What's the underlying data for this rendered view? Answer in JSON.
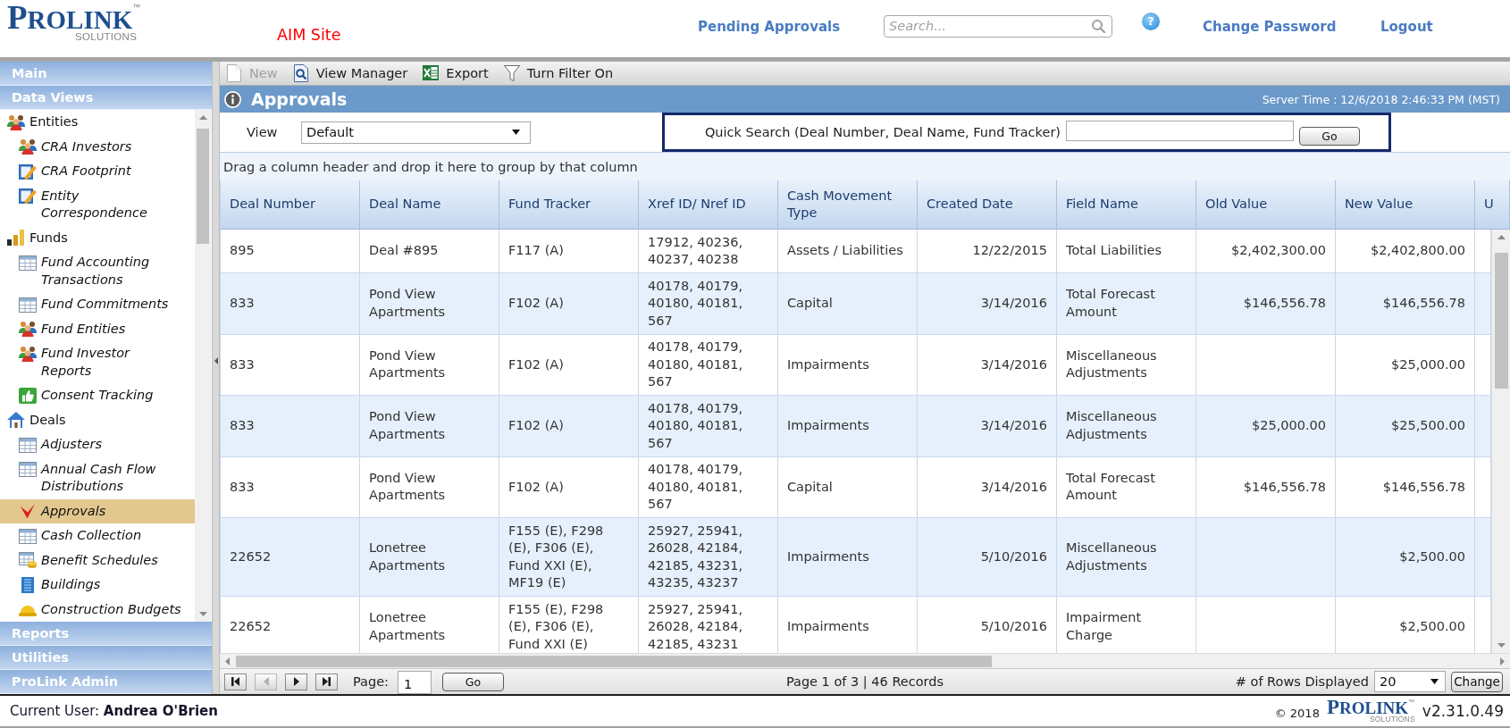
{
  "header": {
    "logo": {
      "wordmark": "PROLINK$^{™}$",
      "tagline": "SOLUTIONS"
    },
    "site_name": "AIM Site",
    "pending_link": "Pending Approvals",
    "search": {
      "placeholder": "Search..."
    },
    "help": "?",
    "account_links": [
      "Change Password",
      "Logout"
    ]
  },
  "sidebar": {
    "sections": [
      {
        "title": "Main"
      },
      {
        "title": "Data Views",
        "tree": [
          {
            "label": "Entities",
            "kind": "people",
            "selected": false,
            "children": [
              {
                "label": "CRA Investors",
                "kind": "people",
                "selected": false
              },
              {
                "label": "CRA Footprint",
                "kind": "note",
                "selected": false
              },
              {
                "label": "Entity Correspondence",
                "kind": "note",
                "selected": false
              }
            ]
          },
          {
            "label": "Funds",
            "kind": "chart",
            "selected": false,
            "children": [
              {
                "label": "Fund Accounting Transactions",
                "kind": "grid",
                "selected": false
              },
              {
                "label": "Fund Commitments",
                "kind": "grid",
                "selected": false
              },
              {
                "label": "Fund Entities",
                "kind": "people",
                "selected": false
              },
              {
                "label": "Fund Investor Reports",
                "kind": "people",
                "selected": false
              },
              {
                "label": "Consent Tracking",
                "kind": "thumb",
                "selected": false
              }
            ]
          },
          {
            "label": "Deals",
            "kind": "home",
            "selected": false,
            "children": [
              {
                "label": "Adjusters",
                "kind": "grid",
                "selected": false
              },
              {
                "label": "Annual Cash Flow Distributions",
                "kind": "grid",
                "selected": false
              },
              {
                "label": "Approvals",
                "kind": "check",
                "selected": true
              },
              {
                "label": "Cash Collection",
                "kind": "grid",
                "selected": false
              },
              {
                "label": "Benefit Schedules",
                "kind": "schedule",
                "selected": false
              },
              {
                "label": "Buildings",
                "kind": "building",
                "selected": false
              },
              {
                "label": "Construction Budgets",
                "kind": "helmet",
                "selected": false
              }
            ]
          }
        ]
      },
      {
        "title": "Reports"
      },
      {
        "title": "Utilities"
      },
      {
        "title": "ProLink Admin"
      }
    ]
  },
  "toolbar": [
    {
      "label": "New",
      "kind": "new",
      "disabled": true
    },
    {
      "label": "View Manager",
      "kind": "views",
      "disabled": false
    },
    {
      "label": "Export",
      "kind": "export",
      "disabled": false
    },
    {
      "label": "Turn Filter On",
      "kind": "filter",
      "disabled": false
    }
  ],
  "panel": {
    "title": "Approvals",
    "server_time": "Server Time : 12/6/2018 2:46:33 PM (MST)"
  },
  "view": {
    "label": "View",
    "value": "Default"
  },
  "quick_search": {
    "label": "Quick Search (Deal Number, Deal Name, Fund Tracker)",
    "button": "Go"
  },
  "group_hint": "Drag a column header and drop it here to group by that column",
  "table": {
    "columns": [
      {
        "label": "Deal Number",
        "kind": "text"
      },
      {
        "label": "Deal Name",
        "kind": "text"
      },
      {
        "label": "Fund Tracker",
        "kind": "text"
      },
      {
        "label": "Xref ID/ Nref ID",
        "kind": "text"
      },
      {
        "label": "Cash Movement Type",
        "kind": "category"
      },
      {
        "label": "Created Date",
        "kind": "number"
      },
      {
        "label": "Field Name",
        "kind": "text"
      },
      {
        "label": "Old Value",
        "kind": "number"
      },
      {
        "label": "New Value",
        "kind": "number"
      },
      {
        "label": "U",
        "kind": "text"
      }
    ],
    "rows": [
      [
        "895",
        "Deal #895",
        "F117 (A)",
        "17912, 40236, 40237, 40238",
        "Assets / Liabilities",
        "12/22/2015",
        "Total Liabilities",
        "$2,402,300.00",
        "$2,402,800.00"
      ],
      [
        "833",
        "Pond View Apartments",
        "F102 (A)",
        "40178, 40179, 40180, 40181, 567",
        "Capital",
        "3/14/2016",
        "Total Forecast Amount",
        "$146,556.78",
        "$146,556.78"
      ],
      [
        "833",
        "Pond View Apartments",
        "F102 (A)",
        "40178, 40179, 40180, 40181, 567",
        "Impairments",
        "3/14/2016",
        "Miscellaneous Adjustments",
        null,
        "$25,000.00"
      ],
      [
        "833",
        "Pond View Apartments",
        "F102 (A)",
        "40178, 40179, 40180, 40181, 567",
        "Impairments",
        "3/14/2016",
        "Miscellaneous Adjustments",
        "$25,000.00",
        "$25,500.00"
      ],
      [
        "833",
        "Pond View Apartments",
        "F102 (A)",
        "40178, 40179, 40180, 40181, 567",
        "Capital",
        "3/14/2016",
        "Total Forecast Amount",
        "$146,556.78",
        "$146,556.78"
      ],
      [
        "22652",
        "Lonetree Apartments",
        "F155 (E), F298 (E), F306 (E), Fund XXI (E), MF19 (E)",
        "25927, 25941, 26028, 42184, 42185, 43231, 43235, 43237",
        "Impairments",
        "5/10/2016",
        "Miscellaneous Adjustments",
        null,
        "$2,500.00"
      ],
      [
        "22652",
        "Lonetree Apartments",
        "F155 (E), F298 (E), F306 (E), Fund XXI (E)",
        "25927, 25941, 26028, 42184, 42185, 43231",
        "Impairments",
        "5/10/2016",
        "Impairment Charge",
        null,
        "$2,500.00"
      ]
    ]
  },
  "pager": {
    "nav": [
      {
        "kind": "first",
        "disabled": false
      },
      {
        "kind": "prev",
        "disabled": true
      },
      {
        "kind": "next",
        "disabled": false
      },
      {
        "kind": "last",
        "disabled": false
      }
    ],
    "page_label": "Page:",
    "page": "1",
    "go": "Go",
    "summary": "Page 1 of 3 | 46 Records",
    "rows_label": "# of Rows Displayed",
    "rows_value": "20",
    "change": "Change"
  },
  "footer": {
    "user": "Current User: **Andrea O'Brien**",
    "copyright": "© 2018",
    "logo": {
      "wordmark": "PROLINK$^{™}$",
      "tagline": "SOLUTIONS"
    },
    "version": "v2.31.0.49"
  }
}
